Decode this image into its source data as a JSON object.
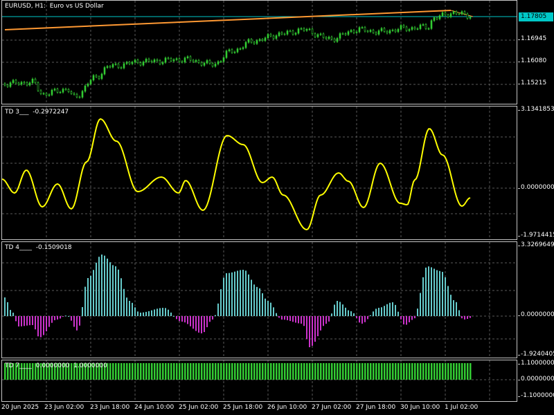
{
  "main": {
    "title": "EURUSD, H1:  Euro vs US Dollar",
    "current_price": "1.17805",
    "y_ticks": [
      "1.16945",
      "1.16080",
      "1.15215"
    ]
  },
  "td3": {
    "label": "TD 3___  -0.2972247",
    "y_ticks": [
      "3.1341853",
      "0.0000000",
      "-1.9714415"
    ]
  },
  "td4": {
    "label": "TD 4____  -0.1509018",
    "y_ticks": [
      "3.3269649",
      "0.0000000",
      "-1.9240405"
    ]
  },
  "td7": {
    "label": "TD 7____  0.0000000  1.0000000",
    "y_ticks": [
      "1.1000000",
      "0.0000000",
      "-1.1000000"
    ]
  },
  "x_axis": {
    "ticks": [
      "20 Jun 2025",
      "23 Jun 02:00",
      "23 Jun 18:00",
      "24 Jun 10:00",
      "25 Jun 02:00",
      "25 Jun 18:00",
      "26 Jun 10:00",
      "27 Jun 02:00",
      "27 Jun 18:00",
      "30 Jun 10:00",
      "1 Jul 02:00"
    ]
  },
  "colors": {
    "background": "#000000",
    "grid": "#5a5a5a",
    "candles": "#33cc33",
    "trendline": "#ff9933",
    "price_line": "#00c8c8",
    "td3_line": "#ffff00",
    "td4_positive": "#66cccc",
    "td4_negative": "#cc33cc",
    "td7_bars": "#33cc33"
  }
}
